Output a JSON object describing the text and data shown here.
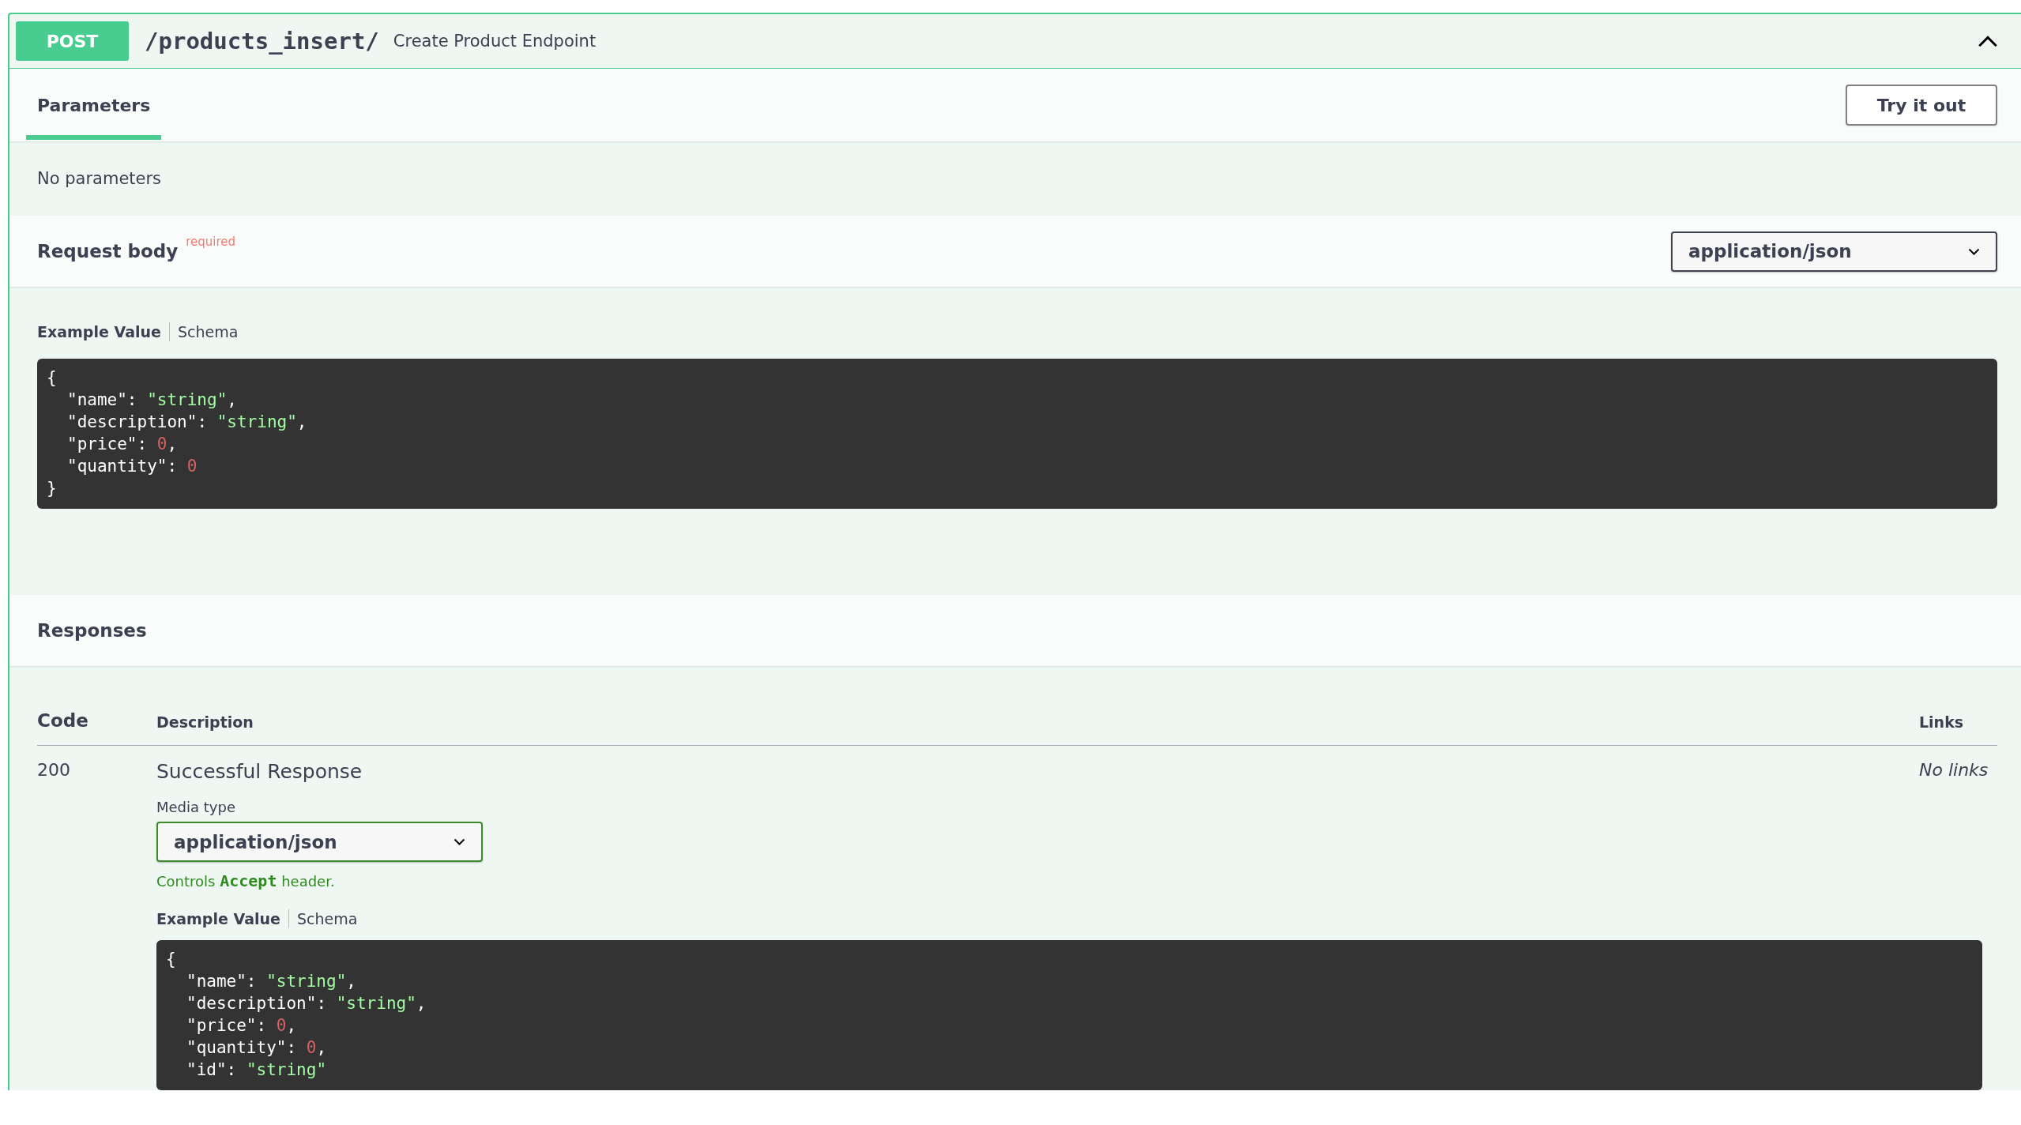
{
  "operation": {
    "method": "POST",
    "path": "/products_insert/",
    "summary": "Create Product Endpoint",
    "expanded": true
  },
  "tabs": [
    {
      "label": "Parameters",
      "selected": true
    }
  ],
  "try_button": "Try it out",
  "parameters_message": "No parameters",
  "request_body": {
    "title": "Request body",
    "required_label": "required",
    "content_type": "application/json",
    "example_tabs": [
      {
        "label": "Example Value",
        "selected": true
      },
      {
        "label": "Schema",
        "selected": false
      }
    ],
    "example": [
      {
        "indented": false,
        "tokens": [
          {
            "kind": "punct",
            "text": "{"
          }
        ]
      },
      {
        "indented": true,
        "tokens": [
          {
            "kind": "key",
            "text": "\"name\""
          },
          {
            "kind": "punct",
            "text": ": "
          },
          {
            "kind": "string",
            "text": "\"string\""
          },
          {
            "kind": "punct",
            "text": ","
          }
        ]
      },
      {
        "indented": true,
        "tokens": [
          {
            "kind": "key",
            "text": "\"description\""
          },
          {
            "kind": "punct",
            "text": ": "
          },
          {
            "kind": "string",
            "text": "\"string\""
          },
          {
            "kind": "punct",
            "text": ","
          }
        ]
      },
      {
        "indented": true,
        "tokens": [
          {
            "kind": "key",
            "text": "\"price\""
          },
          {
            "kind": "punct",
            "text": ": "
          },
          {
            "kind": "number",
            "text": "0"
          },
          {
            "kind": "punct",
            "text": ","
          }
        ]
      },
      {
        "indented": true,
        "tokens": [
          {
            "kind": "key",
            "text": "\"quantity\""
          },
          {
            "kind": "punct",
            "text": ": "
          },
          {
            "kind": "number",
            "text": "0"
          }
        ]
      },
      {
        "indented": false,
        "tokens": [
          {
            "kind": "punct",
            "text": "}"
          }
        ]
      }
    ]
  },
  "responses": {
    "title": "Responses",
    "columns": [
      "Code",
      "Description",
      "Links"
    ],
    "rows": [
      {
        "code": "200",
        "description": "Successful Response",
        "links": "No links",
        "media_type_label": "Media type",
        "media_type": "application/json",
        "hint": {
          "before": "Controls",
          "code": "Accept",
          "after": "header."
        },
        "example_tabs": [
          {
            "label": "Example Value",
            "selected": true
          },
          {
            "label": "Schema",
            "selected": false
          }
        ],
        "example": [
          {
            "indented": false,
            "tokens": [
              {
                "kind": "punct",
                "text": "{"
              }
            ]
          },
          {
            "indented": true,
            "tokens": [
              {
                "kind": "key",
                "text": "\"name\""
              },
              {
                "kind": "punct",
                "text": ": "
              },
              {
                "kind": "string",
                "text": "\"string\""
              },
              {
                "kind": "punct",
                "text": ","
              }
            ]
          },
          {
            "indented": true,
            "tokens": [
              {
                "kind": "key",
                "text": "\"description\""
              },
              {
                "kind": "punct",
                "text": ": "
              },
              {
                "kind": "string",
                "text": "\"string\""
              },
              {
                "kind": "punct",
                "text": ","
              }
            ]
          },
          {
            "indented": true,
            "tokens": [
              {
                "kind": "key",
                "text": "\"price\""
              },
              {
                "kind": "punct",
                "text": ": "
              },
              {
                "kind": "number",
                "text": "0"
              },
              {
                "kind": "punct",
                "text": ","
              }
            ]
          },
          {
            "indented": true,
            "tokens": [
              {
                "kind": "key",
                "text": "\"quantity\""
              },
              {
                "kind": "punct",
                "text": ": "
              },
              {
                "kind": "number",
                "text": "0"
              },
              {
                "kind": "punct",
                "text": ","
              }
            ]
          },
          {
            "indented": true,
            "tokens": [
              {
                "kind": "key",
                "text": "\"id\""
              },
              {
                "kind": "punct",
                "text": ": "
              },
              {
                "kind": "string",
                "text": "\"string\""
              }
            ]
          }
        ]
      }
    ]
  }
}
